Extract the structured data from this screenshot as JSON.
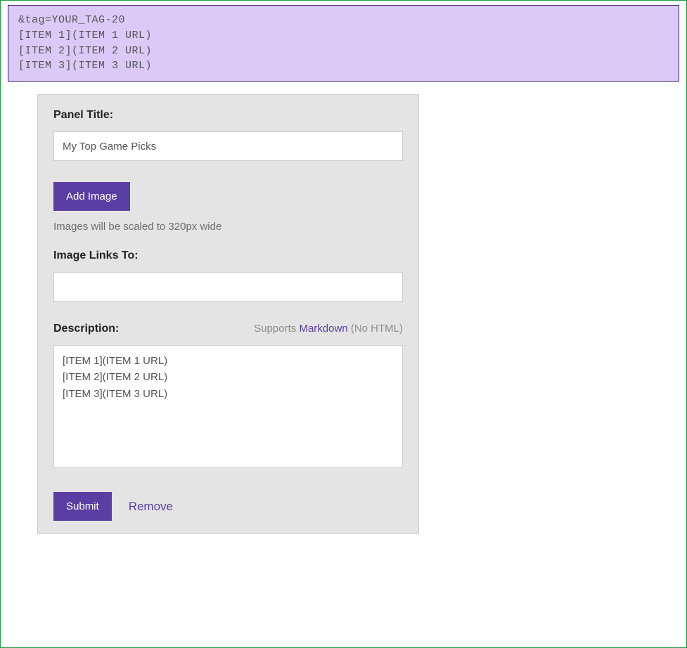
{
  "codeblock": {
    "text": "&tag=YOUR_TAG-20\n[ITEM 1](ITEM 1 URL)\n[ITEM 2](ITEM 2 URL)\n[ITEM 3](ITEM 3 URL)"
  },
  "panel": {
    "title_label": "Panel Title:",
    "title_value": "My Top Game Picks",
    "add_image_label": "Add Image",
    "image_scale_hint": "Images will be scaled to 320px wide",
    "image_links_label": "Image Links To:",
    "image_links_value": "",
    "description_label": "Description:",
    "supports_prefix": "Supports ",
    "markdown_label": "Markdown",
    "supports_suffix": " (No HTML)",
    "description_value": "[ITEM 1](ITEM 1 URL)\n[ITEM 2](ITEM 2 URL)\n[ITEM 3](ITEM 3 URL)",
    "submit_label": "Submit",
    "remove_label": "Remove"
  }
}
